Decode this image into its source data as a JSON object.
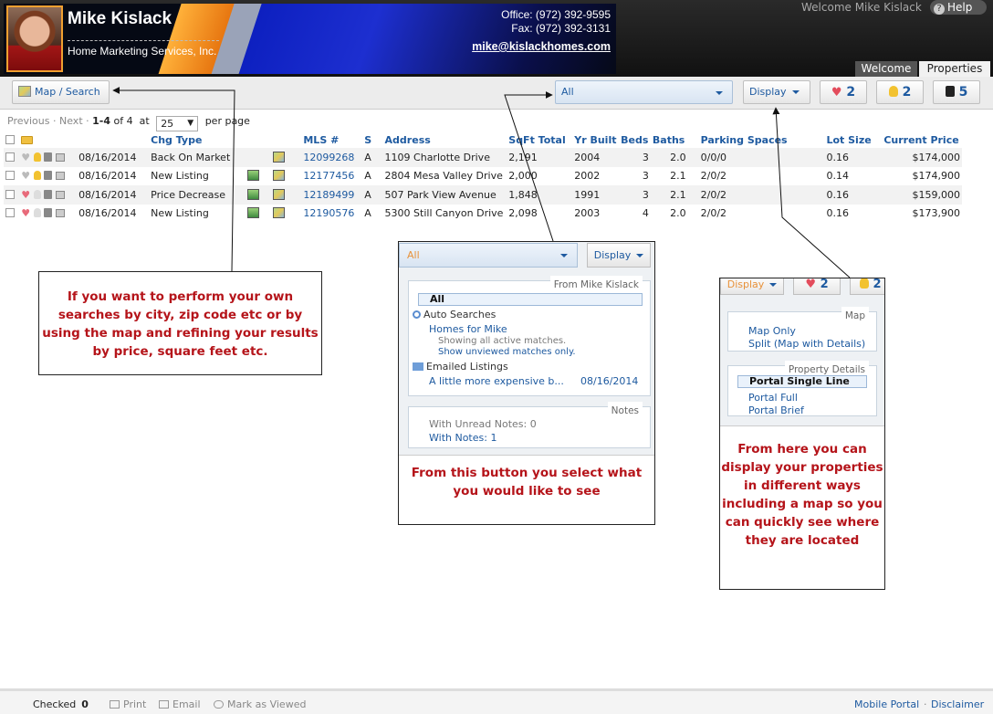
{
  "header": {
    "agent_name": "Mike Kislack",
    "company": "Home Marketing Services, Inc.",
    "office": "Office: (972) 392-9595",
    "fax": "Fax: (972) 392-3131",
    "email": "mike@kislackhomes.com",
    "welcome": "Welcome Mike Kislack",
    "help": "Help",
    "tabs": [
      "Welcome",
      "Properties"
    ]
  },
  "toolbar": {
    "map_search": "Map / Search",
    "filter_value": "All",
    "display": "Display",
    "favorites_count": "2",
    "ideas_count": "2",
    "trash_count": "5"
  },
  "paging": {
    "previous": "Previous",
    "sep1": "·",
    "next": "Next",
    "sep2": "·",
    "range": "1-4",
    "of": "of 4",
    "at": "at",
    "per_page_value": "25",
    "per_page": "per page"
  },
  "table": {
    "headers": [
      "Chg Type",
      "MLS #",
      "S",
      "Address",
      "SqFt Total",
      "Yr Built",
      "Beds",
      "Baths",
      "Parking Spaces",
      "Lot Size",
      "Current Price"
    ],
    "rows": [
      {
        "date": "08/16/2014",
        "chg": "Back On Market",
        "mls": "12099268",
        "s": "A",
        "address": "1109 Charlotte Drive",
        "sqft": "2,191",
        "yr": "2004",
        "beds": "3",
        "baths": "2.0",
        "parking": "0/0/0",
        "lot": "0.16",
        "price": "$174,000"
      },
      {
        "date": "08/16/2014",
        "chg": "New Listing",
        "mls": "12177456",
        "s": "A",
        "address": "2804 Mesa Valley Drive",
        "sqft": "2,000",
        "yr": "2002",
        "beds": "3",
        "baths": "2.1",
        "parking": "2/0/2",
        "lot": "0.14",
        "price": "$174,900"
      },
      {
        "date": "08/16/2014",
        "chg": "Price Decrease",
        "mls": "12189499",
        "s": "A",
        "address": "507 Park View Avenue",
        "sqft": "1,848",
        "yr": "1991",
        "beds": "3",
        "baths": "2.1",
        "parking": "2/0/2",
        "lot": "0.16",
        "price": "$159,000"
      },
      {
        "date": "08/16/2014",
        "chg": "New Listing",
        "mls": "12190576",
        "s": "A",
        "address": "5300 Still Canyon Drive",
        "sqft": "2,098",
        "yr": "2003",
        "beds": "4",
        "baths": "2.0",
        "parking": "2/0/2",
        "lot": "0.16",
        "price": "$173,900"
      }
    ]
  },
  "callouts": {
    "left": "If you want to perform your own searches by city, zip code etc or by using the map and refining your results by price, square feet etc.",
    "mid": "From this button you select what you would like to see",
    "right": "From here you can display your properties in different ways including a map so you can quickly see where they are located"
  },
  "filter_menu": {
    "select": "All",
    "display": "Display",
    "from_heading": "From Mike Kislack",
    "all": "All",
    "auto_searches": "Auto Searches",
    "homes_for": "Homes for Mike",
    "showing_all": "Showing all active matches.",
    "show_unviewed": "Show unviewed matches only.",
    "emailed": "Emailed Listings",
    "emailed_item": "A little more expensive b...",
    "emailed_date": "08/16/2014",
    "notes_heading": "Notes",
    "unread_notes": "With Unread Notes: 0",
    "with_notes": "With Notes: 1"
  },
  "display_menu": {
    "display": "Display",
    "fav_count": "2",
    "idea_count": "2",
    "map_heading": "Map",
    "map_only": "Map Only",
    "split": "Split (Map with Details)",
    "details_heading": "Property Details",
    "single_line": "Portal Single Line",
    "full": "Portal Full",
    "brief": "Portal Brief"
  },
  "footer": {
    "checked": "Checked",
    "checked_count": "0",
    "print": "Print",
    "email": "Email",
    "mark_viewed": "Mark as Viewed",
    "mobile": "Mobile Portal",
    "sep": "·",
    "disclaimer": "Disclaimer"
  },
  "colors": {
    "accent": "#1e5aa0",
    "callout_text": "#b5141a",
    "favorite": "#e34c5c"
  }
}
